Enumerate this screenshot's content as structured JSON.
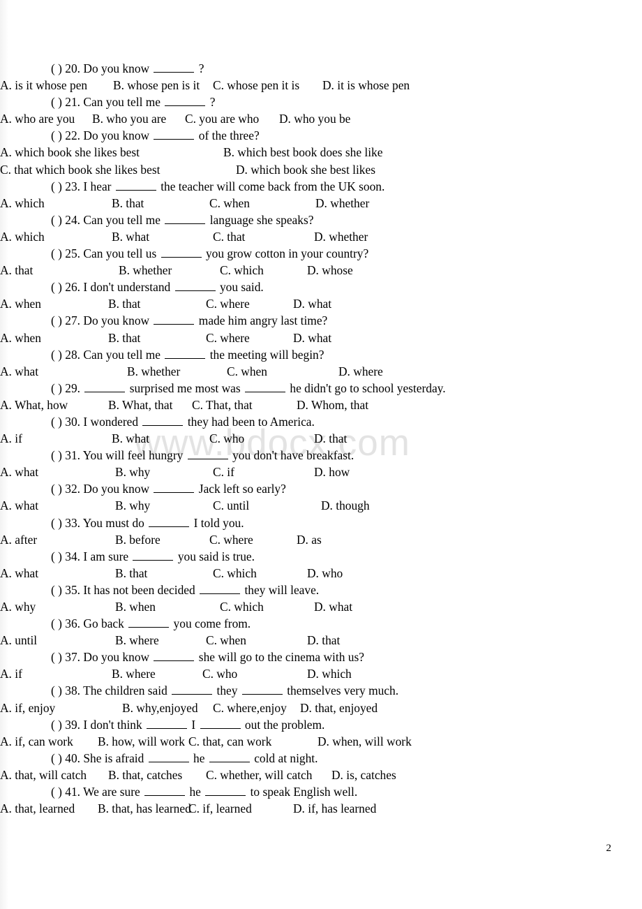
{
  "watermark": "www.bdocx.com",
  "page_number": "2",
  "blank_marker": "______",
  "questions": [
    {
      "marker": "( ) 20.",
      "stem_before": "Do you know",
      "stem_after": "?",
      "blanks": 1,
      "layout": "row4",
      "columns": [
        0,
        162,
        305,
        462
      ],
      "options": [
        "A. is it whose pen",
        "B. whose pen is it",
        "C. whose pen it is",
        "D. it is whose pen"
      ]
    },
    {
      "marker": "( ) 21.",
      "stem_before": "Can you tell me",
      "stem_after": "?",
      "blanks": 1,
      "layout": "row4",
      "columns": [
        0,
        132,
        265,
        400
      ],
      "options": [
        "A. who are you",
        "B. who you are",
        "C. you are who",
        "D. who you be"
      ]
    },
    {
      "marker": "( ) 22.",
      "stem_before": "Do you know",
      "stem_after": "of the three?",
      "blanks": 1,
      "layout": "grid2",
      "columns": [
        0,
        320
      ],
      "options": [
        "A. which book she likes best",
        "B. which best book does she like",
        "C. that which book she likes best",
        "D. which book she best likes"
      ]
    },
    {
      "marker": "( ) 23.",
      "stem_before": "I hear",
      "stem_after": "the teacher will come back from the UK soon.",
      "blanks": 1,
      "layout": "row4",
      "columns": [
        0,
        160,
        300,
        452
      ],
      "options": [
        "A. which",
        "B. that",
        "C. when",
        "D. whether"
      ]
    },
    {
      "marker": "( ) 24.",
      "stem_before": "Can you tell me",
      "stem_after": "language she speaks?",
      "blanks": 1,
      "layout": "row4",
      "columns": [
        0,
        160,
        305,
        450
      ],
      "options": [
        "A. which",
        "B. what",
        "C. that",
        "D. whether"
      ]
    },
    {
      "marker": "( ) 25.",
      "stem_before": "Can you tell us",
      "stem_after": "you grow cotton in your country?",
      "blanks": 1,
      "layout": "row4",
      "columns": [
        0,
        170,
        315,
        440
      ],
      "options": [
        "A. that",
        "B. whether",
        "C. which",
        "D. whose"
      ]
    },
    {
      "marker": "( ) 26.",
      "stem_before": "I don't understand",
      "stem_after": "you said.",
      "blanks": 1,
      "layout": "row4",
      "columns": [
        0,
        155,
        295,
        420
      ],
      "options": [
        "A. when",
        "B. that",
        "C. where",
        "D. what"
      ]
    },
    {
      "marker": "( ) 27.",
      "stem_before": "Do you know",
      "stem_after": "made him angry last time?",
      "blanks": 1,
      "layout": "row4",
      "columns": [
        0,
        155,
        295,
        420
      ],
      "options": [
        "A. when",
        "B. that",
        "C. where",
        "D. what"
      ]
    },
    {
      "marker": "( ) 28.",
      "stem_before": "Can you tell me",
      "stem_after": "the meeting will begin?",
      "blanks": 1,
      "layout": "row4",
      "columns": [
        0,
        182,
        325,
        485
      ],
      "options": [
        "A. what",
        "B. whether",
        "C. when",
        "D. where"
      ]
    },
    {
      "marker": "( ) 29.",
      "stem_before": "",
      "stem_mid": "surprised me most was",
      "stem_after": "he didn't go to school yesterday.",
      "blanks": 2,
      "layout": "row4",
      "columns": [
        0,
        155,
        275,
        425
      ],
      "options": [
        "A. What, how",
        "B. What, that",
        "C. That, that",
        "D. Whom, that"
      ]
    },
    {
      "marker": "( ) 30.",
      "stem_before": "I wondered",
      "stem_after": "they had been to America.",
      "blanks": 1,
      "layout": "row4",
      "flush": true,
      "columns": [
        0,
        160,
        300,
        450
      ],
      "options": [
        "A. if",
        "B. what",
        "C. who",
        "D. that"
      ]
    },
    {
      "marker": "( ) 31.",
      "stem_before": "You will feel hungry",
      "stem_after": "you don't have breakfast.",
      "blanks": 1,
      "layout": "row4",
      "columns": [
        0,
        165,
        305,
        450
      ],
      "options": [
        "A. what",
        "B. why",
        "C. if",
        "D. how"
      ]
    },
    {
      "marker": "( ) 32.",
      "stem_before": "Do you know",
      "stem_after": "Jack left so early?",
      "blanks": 1,
      "layout": "row4",
      "columns": [
        0,
        165,
        305,
        460
      ],
      "options": [
        "A. what",
        "B. why",
        "C. until",
        "D. though"
      ]
    },
    {
      "marker": "( ) 33.",
      "stem_before": "You must do",
      "stem_after": "I told you.",
      "blanks": 1,
      "layout": "row4",
      "columns": [
        0,
        165,
        300,
        425
      ],
      "options": [
        "A. after",
        "B. before",
        "C. where",
        "D. as"
      ]
    },
    {
      "marker": "( ) 34.",
      "stem_before": "I am sure",
      "stem_after": "you said is true.",
      "blanks": 1,
      "layout": "row4",
      "flush": true,
      "columns": [
        0,
        165,
        305,
        440
      ],
      "options": [
        "A. what",
        "B. that",
        "C. which",
        "D. who"
      ]
    },
    {
      "marker": "( ) 35.",
      "stem_before": "It has not been decided",
      "stem_after": "they will leave.",
      "blanks": 1,
      "layout": "row4",
      "columns": [
        0,
        165,
        315,
        450
      ],
      "options": [
        "A. why",
        "B. when",
        "C. which",
        "D. what"
      ]
    },
    {
      "marker": "( ) 36.",
      "stem_before": "Go back",
      "stem_after": "you come from.",
      "blanks": 1,
      "layout": "row4",
      "columns": [
        0,
        165,
        295,
        440
      ],
      "options": [
        "A. until",
        "B. where",
        "C. when",
        "D. that"
      ]
    },
    {
      "marker": "( ) 37.",
      "stem_before": "Do you know",
      "stem_after": "she will go to the cinema with us?",
      "blanks": 1,
      "layout": "row4",
      "columns": [
        0,
        160,
        290,
        440
      ],
      "options": [
        "A. if",
        "B. where",
        "C. who",
        "D. which"
      ]
    },
    {
      "marker": "( ) 38.",
      "stem_before": "The children said",
      "stem_mid": "they",
      "stem_after": "themselves very much.",
      "blanks": 2,
      "layout": "row4",
      "columns": [
        0,
        175,
        305,
        430
      ],
      "options": [
        "A. if, enjoy",
        "B. why,enjoyed",
        "C. where,enjoy",
        "D. that, enjoyed"
      ]
    },
    {
      "marker": "( ) 39.",
      "stem_before": "I don't think",
      "stem_mid": "I",
      "stem_after": "out the problem.",
      "blanks": 2,
      "layout": "row4",
      "columns": [
        0,
        140,
        270,
        455
      ],
      "options": [
        "A. if, can work",
        "B. how, will work",
        "C. that, can work",
        "D. when, will work"
      ]
    },
    {
      "marker": "( ) 40.",
      "stem_before": "She is afraid",
      "stem_mid": "he",
      "stem_after": "cold at night.",
      "blanks": 2,
      "layout": "row4",
      "columns": [
        0,
        155,
        295,
        475
      ],
      "options": [
        "A. that, will catch",
        "B. that, catches",
        "C. whether, will catch",
        "D. is, catches"
      ]
    },
    {
      "marker": "( ) 41.",
      "stem_before": "We are sure",
      "stem_mid": "he",
      "stem_after": "to speak English well.",
      "blanks": 2,
      "layout": "row4",
      "columns": [
        0,
        140,
        270,
        420
      ],
      "options": [
        "A. that, learned",
        "B. that, has learned",
        "C. if, learned",
        "D. if, has learned"
      ]
    }
  ]
}
